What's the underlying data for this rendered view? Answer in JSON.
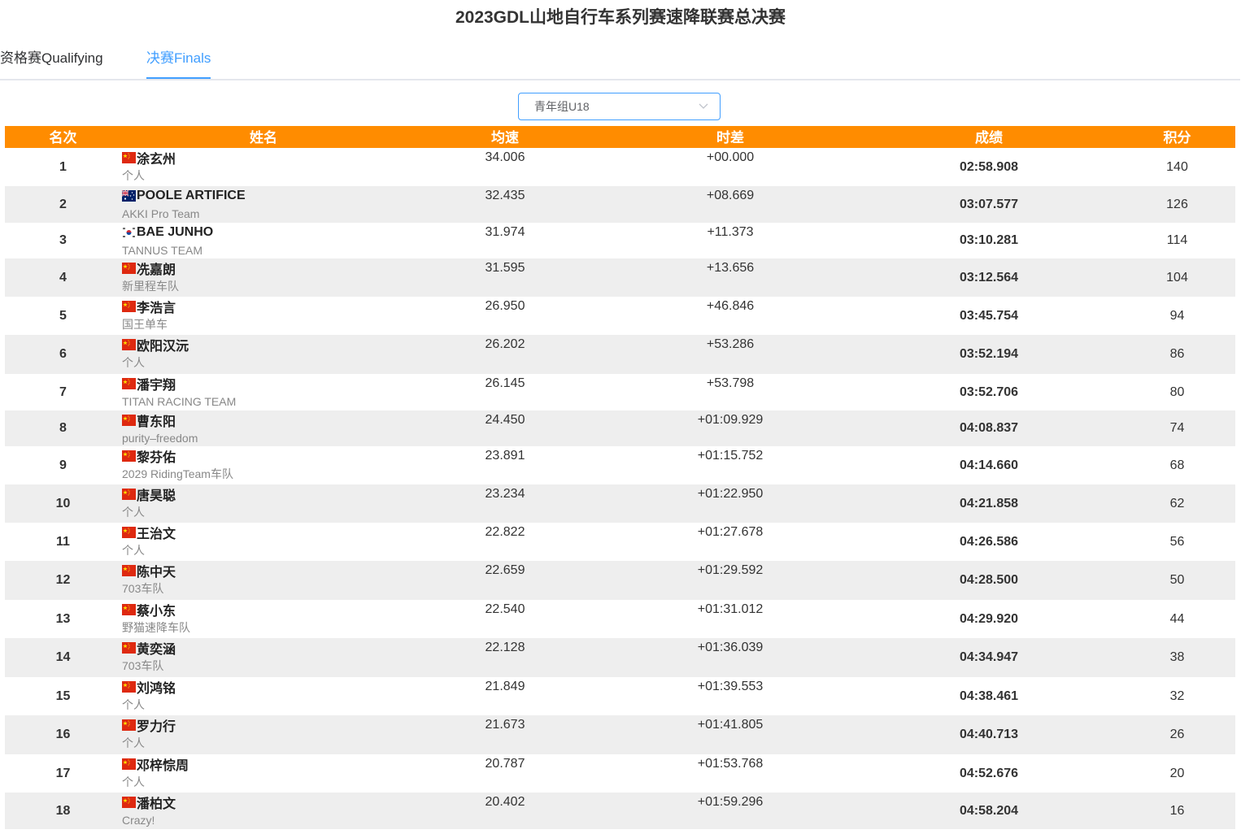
{
  "title": "2023GDL山地自行车系列赛速降联赛总决赛",
  "tabs": [
    {
      "label": "资格赛Qualifying",
      "active": false
    },
    {
      "label": "决赛Finals",
      "active": true
    }
  ],
  "category_select": {
    "value": "青年组U18"
  },
  "colors": {
    "header": "#ff8c00",
    "accent": "#409eff",
    "row_even": "#eeeeee"
  },
  "table": {
    "headers": {
      "rank": "名次",
      "name": "姓名",
      "speed": "均速",
      "gap": "时差",
      "result": "成绩",
      "points": "积分"
    },
    "rows": [
      {
        "rank": "1",
        "flag": "china-flag-icon",
        "name": "涂玄州",
        "team": "个人",
        "speed": "34.006",
        "gap": "+00.000",
        "result": "02:58.908",
        "points": "140"
      },
      {
        "rank": "2",
        "flag": "australia-flag-icon",
        "name": "POOLE ARTIFICE",
        "team": "AKKI Pro Team",
        "speed": "32.435",
        "gap": "+08.669",
        "result": "03:07.577",
        "points": "126"
      },
      {
        "rank": "3",
        "flag": "south-korea-flag-icon",
        "name": "BAE JUNHO",
        "team": "TANNUS TEAM",
        "speed": "31.974",
        "gap": "+11.373",
        "result": "03:10.281",
        "points": "114"
      },
      {
        "rank": "4",
        "flag": "china-flag-icon",
        "name": "冼嘉朗",
        "team": "新里程车队",
        "speed": "31.595",
        "gap": "+13.656",
        "result": "03:12.564",
        "points": "104"
      },
      {
        "rank": "5",
        "flag": "china-flag-icon",
        "name": "李浩言",
        "team": "国王单车",
        "speed": "26.950",
        "gap": "+46.846",
        "result": "03:45.754",
        "points": "94"
      },
      {
        "rank": "6",
        "flag": "china-flag-icon",
        "name": "欧阳汉沅",
        "team": "个人",
        "speed": "26.202",
        "gap": "+53.286",
        "result": "03:52.194",
        "points": "86"
      },
      {
        "rank": "7",
        "flag": "china-flag-icon",
        "name": "潘宇翔",
        "team": "TITAN RACING TEAM",
        "speed": "26.145",
        "gap": "+53.798",
        "result": "03:52.706",
        "points": "80"
      },
      {
        "rank": "8",
        "flag": "china-flag-icon",
        "name": "曹东阳",
        "team": "purity–freedom",
        "speed": "24.450",
        "gap": "+01:09.929",
        "result": "04:08.837",
        "points": "74"
      },
      {
        "rank": "9",
        "flag": "china-flag-icon",
        "name": "黎芬佑",
        "team": "2029 RidingTeam车队",
        "speed": "23.891",
        "gap": "+01:15.752",
        "result": "04:14.660",
        "points": "68"
      },
      {
        "rank": "10",
        "flag": "china-flag-icon",
        "name": "唐昊聪",
        "team": "个人",
        "speed": "23.234",
        "gap": "+01:22.950",
        "result": "04:21.858",
        "points": "62"
      },
      {
        "rank": "11",
        "flag": "china-flag-icon",
        "name": "王治文",
        "team": "个人",
        "speed": "22.822",
        "gap": "+01:27.678",
        "result": "04:26.586",
        "points": "56"
      },
      {
        "rank": "12",
        "flag": "china-flag-icon",
        "name": "陈中天",
        "team": "703车队",
        "speed": "22.659",
        "gap": "+01:29.592",
        "result": "04:28.500",
        "points": "50"
      },
      {
        "rank": "13",
        "flag": "china-flag-icon",
        "name": "蔡小东",
        "team": "野猫速降车队",
        "speed": "22.540",
        "gap": "+01:31.012",
        "result": "04:29.920",
        "points": "44"
      },
      {
        "rank": "14",
        "flag": "china-flag-icon",
        "name": "黄奕涵",
        "team": "703车队",
        "speed": "22.128",
        "gap": "+01:36.039",
        "result": "04:34.947",
        "points": "38"
      },
      {
        "rank": "15",
        "flag": "china-flag-icon",
        "name": "刘鸿铭",
        "team": "个人",
        "speed": "21.849",
        "gap": "+01:39.553",
        "result": "04:38.461",
        "points": "32"
      },
      {
        "rank": "16",
        "flag": "china-flag-icon",
        "name": "罗力行",
        "team": "个人",
        "speed": "21.673",
        "gap": "+01:41.805",
        "result": "04:40.713",
        "points": "26"
      },
      {
        "rank": "17",
        "flag": "china-flag-icon",
        "name": "邓梓悰周",
        "team": "个人",
        "speed": "20.787",
        "gap": "+01:53.768",
        "result": "04:52.676",
        "points": "20"
      },
      {
        "rank": "18",
        "flag": "china-flag-icon",
        "name": "潘柏文",
        "team": "Crazy!",
        "speed": "20.402",
        "gap": "+01:59.296",
        "result": "04:58.204",
        "points": "16"
      }
    ]
  }
}
